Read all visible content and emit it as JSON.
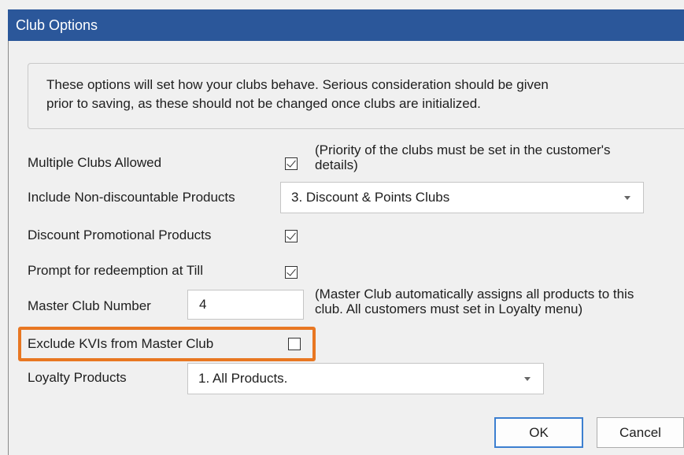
{
  "window": {
    "title": "Club Options"
  },
  "info": {
    "line1": "These options will set how your clubs behave.  Serious consideration should be given",
    "line2": "prior to saving, as these should not be changed once clubs are initialized."
  },
  "multiple_clubs": {
    "label": "Multiple Clubs Allowed",
    "checked": true,
    "note_line1": "(Priority of the clubs must be set in the customer's",
    "note_line2": "details)"
  },
  "non_discountable": {
    "label": "Include Non-discountable Products",
    "value": "3. Discount & Points Clubs"
  },
  "discount_promotional": {
    "label": "Discount Promotional Products",
    "checked": true
  },
  "prompt_redemption": {
    "label": "Prompt for redeemption at Till",
    "checked": true
  },
  "master_club": {
    "label": "Master Club Number",
    "value": "4",
    "note_line1": "(Master Club automatically assigns all products to this",
    "note_line2": "club.  All customers must set in Loyalty menu)"
  },
  "exclude_kvis": {
    "label": "Exclude KVIs from Master Club",
    "checked": false
  },
  "loyalty_products": {
    "label": "Loyalty Products",
    "value": "1. All Products."
  },
  "buttons": {
    "ok": "OK",
    "cancel": "Cancel"
  },
  "colors": {
    "titlebar": "#2b579a",
    "highlight": "#e87722",
    "default_button_border": "#3c7fd0"
  }
}
